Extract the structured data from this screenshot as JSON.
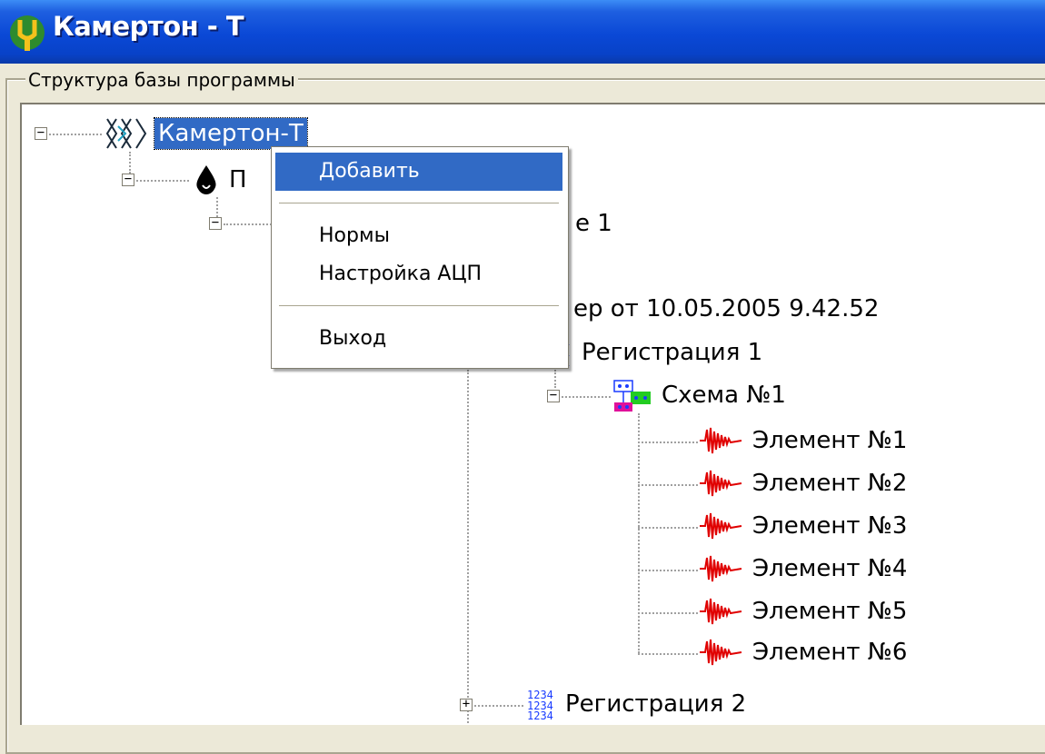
{
  "window": {
    "title": "Камертон - Т",
    "app_icon": "tuning-fork-app-icon"
  },
  "groupbox": {
    "label": "Структура базы программы"
  },
  "tree": {
    "root": {
      "label": "Камертон-Т",
      "icon": "tuning-fork-pattern-icon",
      "selected": true
    },
    "level1": {
      "label_visible": "П",
      "icon": "drop-icon"
    },
    "level2": {
      "label_visible": "е 1"
    },
    "level3": {
      "label_visible": "ер от 10.05.2005 9.42.52"
    },
    "registrations": [
      {
        "label": "Регистрация 1",
        "icon": "registration-numbers-icon",
        "expanded": true
      },
      {
        "label": "Регистрация 2",
        "icon": "registration-numbers-icon",
        "expanded": false
      }
    ],
    "scheme": {
      "label": "Схема №1",
      "icon": "scheme-blocks-icon"
    },
    "elements": [
      "Элемент №1",
      "Элемент №2",
      "Элемент №3",
      "Элемент №4",
      "Элемент №5",
      "Элемент №6"
    ],
    "element_icon": "waveform-icon"
  },
  "context_menu": {
    "items": [
      "Добавить",
      "Нормы",
      "Настройка АЦП",
      "Выход"
    ],
    "highlighted": "Добавить"
  },
  "colors": {
    "titlebar": "#0a48d6",
    "selection": "#316ac5",
    "waveform": "#e00000",
    "registration_icon": "#1a3cff"
  }
}
